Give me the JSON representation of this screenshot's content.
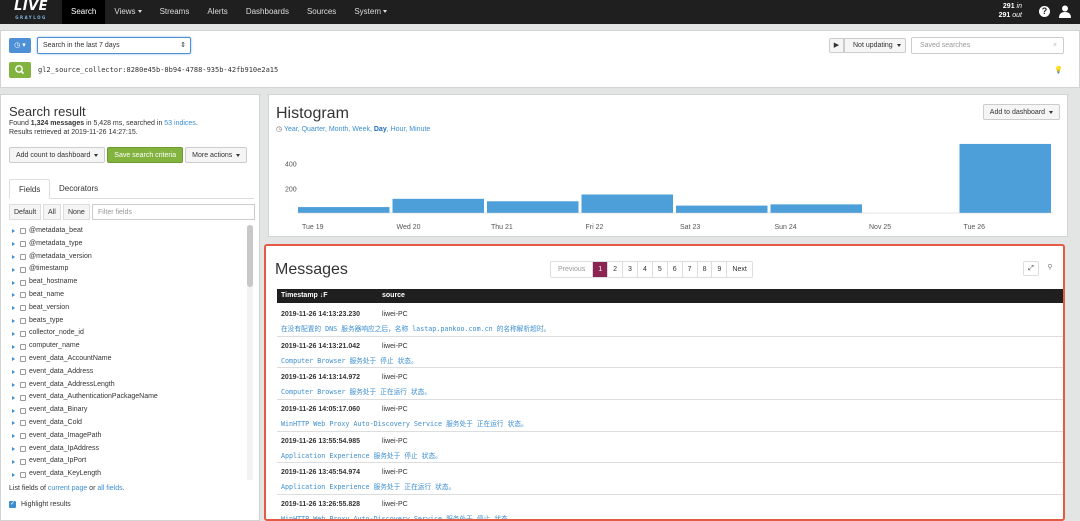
{
  "nav": {
    "logo": "LIVE",
    "logo_sub": "GRAYLOG",
    "items": [
      {
        "label": "Search",
        "active": true,
        "dropdown": false
      },
      {
        "label": "Views",
        "active": false,
        "dropdown": true
      },
      {
        "label": "Streams",
        "active": false,
        "dropdown": false
      },
      {
        "label": "Alerts",
        "active": false,
        "dropdown": false
      },
      {
        "label": "Dashboards",
        "active": false,
        "dropdown": false
      },
      {
        "label": "Sources",
        "active": false,
        "dropdown": false
      },
      {
        "label": "System",
        "active": false,
        "dropdown": true
      }
    ],
    "throughput_in": "291",
    "throughput_in_label": "in",
    "throughput_out": "291",
    "throughput_out_label": "out",
    "help_icon": "?",
    "user_icon": "user-icon"
  },
  "search": {
    "timerange_type_icon": "clock-icon",
    "timerange": "Search in the last 7 days",
    "update_label": "Not updating",
    "saved_searches_placeholder": "Saved searches",
    "query": "gl2_source_collector:8280e45b-8b94-4788-935b-42fb910e2a15"
  },
  "result": {
    "title": "Search result",
    "found_prefix": "Found ",
    "found_count": "1,324 messages",
    "found_mid": " in 5,428 ms, searched in ",
    "indices_link": "53 indices",
    "found_suffix": ".",
    "retrieved": "Results retrieved at 2019-11-26 14:27:15.",
    "btn_add_count": "Add count to dashboard",
    "btn_save": "Save search criteria",
    "btn_more": "More actions"
  },
  "sidebar": {
    "tabs": [
      "Fields",
      "Decorators"
    ],
    "filter_buttons": [
      "Default",
      "All",
      "None"
    ],
    "filter_placeholder": "Filter fields",
    "fields": [
      "@metadata_beat",
      "@metadata_type",
      "@metadata_version",
      "@timestamp",
      "beat_hostname",
      "beat_name",
      "beat_version",
      "beats_type",
      "collector_node_id",
      "computer_name",
      "event_data_AccountName",
      "event_data_Address",
      "event_data_AddressLength",
      "event_data_AuthenticationPackageName",
      "event_data_Binary",
      "event_data_Cold",
      "event_data_ImagePath",
      "event_data_IpAddress",
      "event_data_IpPort",
      "event_data_KeyLength"
    ],
    "list_prefix": "List fields of ",
    "list_current": "current page",
    "list_or": " or ",
    "list_all": "all fields",
    "list_suffix": ".",
    "highlight": "Highlight results"
  },
  "histogram": {
    "title": "Histogram",
    "resolutions": [
      "Year",
      "Quarter",
      "Month",
      "Week",
      "Day",
      "Hour",
      "Minute"
    ],
    "active_resolution": "Day",
    "add_to_dashboard": "Add to dashboard"
  },
  "chart_data": {
    "type": "bar",
    "categories": [
      "Tue 19",
      "Wed 20",
      "Thu 21",
      "Fri 22",
      "Sat 23",
      "Sun 24",
      "Nov 25",
      "Tue 26"
    ],
    "bars": [
      {
        "start": 0,
        "end": 1,
        "value": 48
      },
      {
        "start": 1,
        "end": 2,
        "value": 115
      },
      {
        "start": 2,
        "end": 3,
        "value": 95
      },
      {
        "start": 3,
        "end": 4,
        "value": 150
      },
      {
        "start": 4,
        "end": 5,
        "value": 60
      },
      {
        "start": 5,
        "end": 6,
        "value": 70
      },
      {
        "start": 6,
        "end": 7,
        "value": 0
      },
      {
        "start": 7,
        "end": 8,
        "value": 560
      }
    ],
    "yticks": [
      "400",
      "200"
    ],
    "ylim": [
      0,
      600
    ],
    "color": "#4d9fd9"
  },
  "messages": {
    "title": "Messages",
    "pager": [
      "Previous",
      "1",
      "2",
      "3",
      "4",
      "5",
      "6",
      "7",
      "8",
      "9",
      "Next"
    ],
    "active_page": "1",
    "col_timestamp": "Timestamp",
    "col_timestamp_sort": "↓F",
    "col_source": "source",
    "rows": [
      {
        "timestamp": "2019-11-26 14:13:23.230",
        "source": "liwei-PC",
        "message": "在没有配置的 DNS 服务器响应之后，名称 lastap.pankoo.com.cn 的名称解析超时。"
      },
      {
        "timestamp": "2019-11-26 14:13:21.042",
        "source": "liwei-PC",
        "message": "Computer Browser 服务处于 停止 状态。"
      },
      {
        "timestamp": "2019-11-26 14:13:14.972",
        "source": "liwei-PC",
        "message": "Computer Browser 服务处于 正在运行 状态。"
      },
      {
        "timestamp": "2019-11-26 14:05:17.060",
        "source": "liwei-PC",
        "message": "WinHTTP Web Proxy Auto-Discovery Service 服务处于 正在运行 状态。"
      },
      {
        "timestamp": "2019-11-26 13:55:54.985",
        "source": "liwei-PC",
        "message": "Application Experience 服务处于 停止 状态。"
      },
      {
        "timestamp": "2019-11-26 13:45:54.974",
        "source": "liwei-PC",
        "message": "Application Experience 服务处于 正在运行 状态。"
      },
      {
        "timestamp": "2019-11-26 13:26:55.828",
        "source": "liwei-PC",
        "message": "WinHTTP Web Proxy Auto-Discovery Service 服务处于 停止 状态。"
      }
    ]
  }
}
